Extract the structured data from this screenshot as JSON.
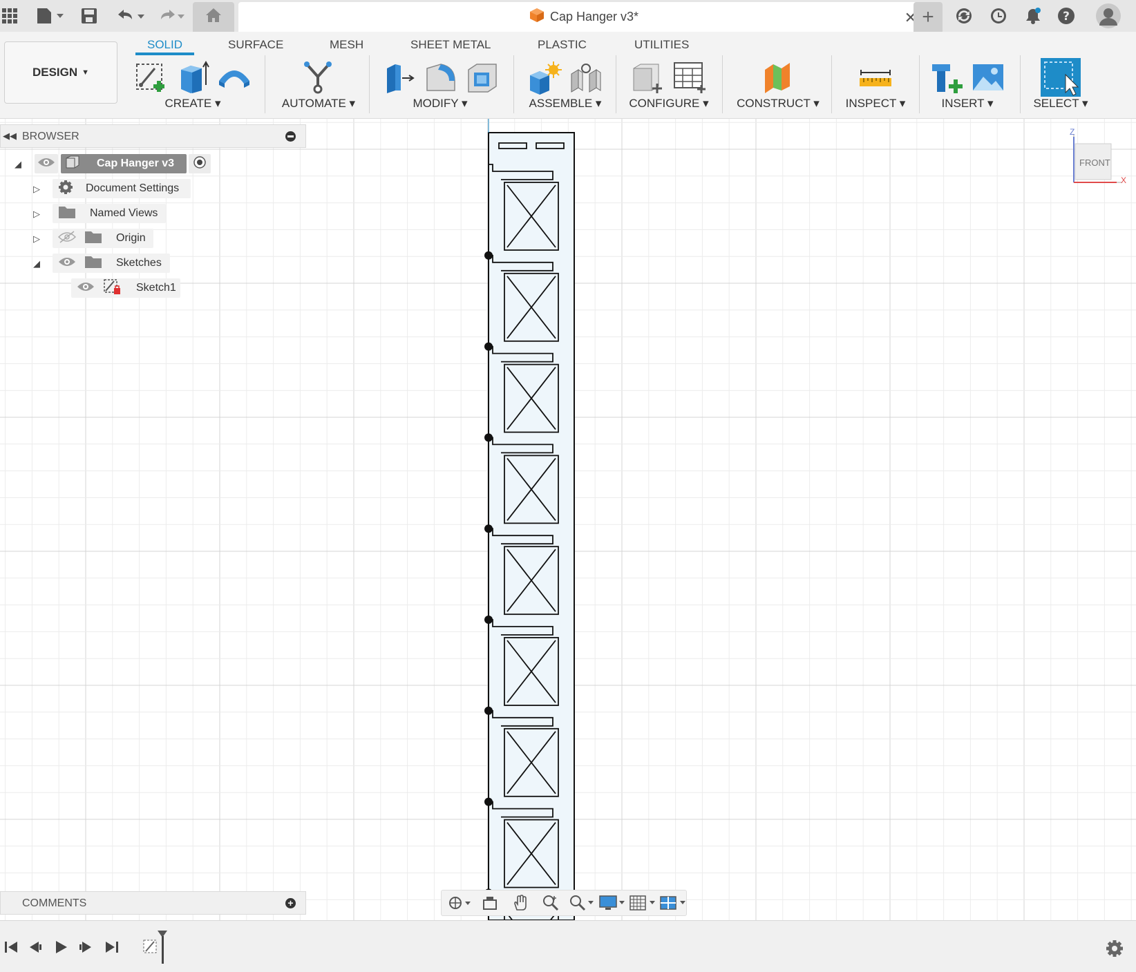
{
  "title_bar": {
    "document_title": "Cap Hanger v3*",
    "icons": [
      "apps-grid-icon",
      "file-icon",
      "save-icon",
      "undo-icon",
      "redo-icon",
      "home-icon",
      "close-icon",
      "plus-icon",
      "refresh-icon",
      "clock-icon",
      "bell-icon",
      "help-icon",
      "avatar"
    ]
  },
  "workspace": {
    "label": "DESIGN"
  },
  "ribbon_tabs": [
    "SOLID",
    "SURFACE",
    "MESH",
    "SHEET METAL",
    "PLASTIC",
    "UTILITIES"
  ],
  "active_tab": "SOLID",
  "ribbon_groups": [
    "CREATE",
    "AUTOMATE",
    "MODIFY",
    "ASSEMBLE",
    "CONFIGURE",
    "CONSTRUCT",
    "INSPECT",
    "INSERT",
    "SELECT"
  ],
  "browser": {
    "header": "BROWSER",
    "root": "Cap Hanger v3",
    "items": [
      {
        "label": "Document Settings"
      },
      {
        "label": "Named Views"
      },
      {
        "label": "Origin"
      },
      {
        "label": "Sketches"
      },
      {
        "label": "Sketch1"
      }
    ]
  },
  "comments": {
    "header": "COMMENTS"
  },
  "viewcube": {
    "face": "FRONT",
    "axis_z": "Z",
    "axis_x": "X"
  },
  "colors": {
    "accent": "#1e8cc8",
    "ribbon_bg": "#f3f3f3",
    "titlebar_bg": "#e6e6e6",
    "sketch_fill": "#eef6fb",
    "grid_minor": "#ececec",
    "grid_major": "#d4d4d4"
  }
}
